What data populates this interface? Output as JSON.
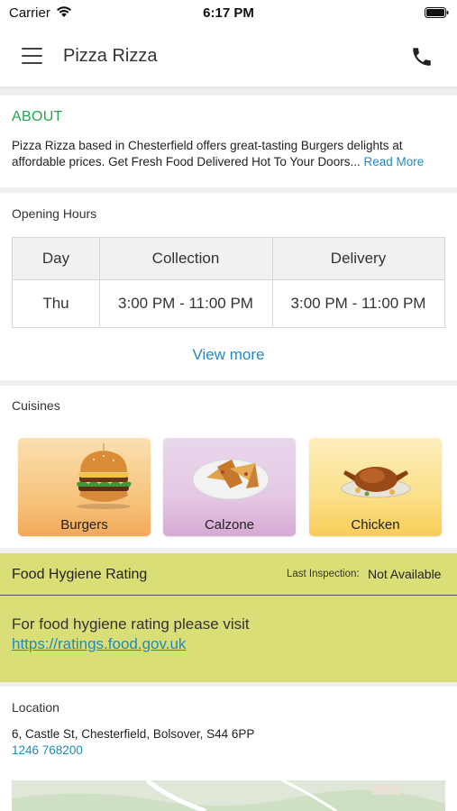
{
  "status_bar": {
    "carrier": "Carrier",
    "time": "6:17 PM"
  },
  "nav": {
    "title": "Pizza Rizza",
    "menu_icon": "hamburger-menu-icon",
    "call_icon": "phone-icon"
  },
  "about": {
    "title": "ABOUT",
    "text_line1": "Pizza Rizza based in Chesterfield offers great-tasting Burgers delights at",
    "text_line2": "affordable prices. Get Fresh Food Delivered Hot To Your Doors...",
    "read_more": "Read More"
  },
  "hours": {
    "label": "Opening Hours",
    "columns": [
      "Day",
      "Collection",
      "Delivery"
    ],
    "rows": [
      {
        "day": "Thu",
        "collection": "3:00 PM - 11:00 PM",
        "delivery": "3:00 PM - 11:00 PM"
      }
    ],
    "view_more": "View more"
  },
  "cuisines": {
    "label": "Cuisines",
    "items": [
      {
        "name": "Burgers",
        "icon": "burger-image"
      },
      {
        "name": "Calzone",
        "icon": "calzone-image"
      },
      {
        "name": "Chicken",
        "icon": "roast-chicken-image"
      }
    ]
  },
  "hygiene": {
    "title": "Food Hygiene Rating",
    "last_inspection_label": "Last Inspection:",
    "last_inspection_value": "Not Available",
    "info": "For food hygiene rating please visit",
    "link": "https://ratings.food.gov.uk"
  },
  "location": {
    "label": "Location",
    "address": "6, Castle St, Chesterfield, Bolsover, S44 6PP",
    "phone": "1246 768200"
  },
  "colors": {
    "about_title": "#22a84a",
    "link": "#1f8ac0",
    "hygiene_bg": "#d9df76",
    "burgers_tile": "#f6c27a",
    "calzone_tile": "#e4c8e4",
    "chicken_tile": "#fbe08a"
  }
}
